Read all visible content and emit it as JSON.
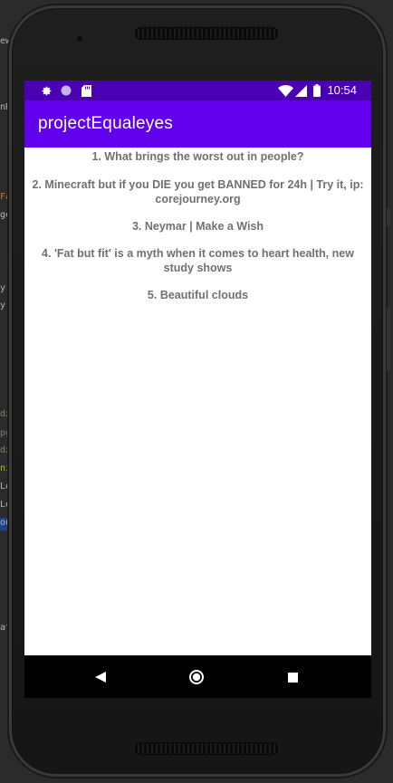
{
  "ide": {
    "fragments": [
      "ew",
      "nR",
      "Fa",
      "ge",
      "y",
      "y",
      "dx",
      "pg",
      "dx",
      "ni.",
      "Lo",
      "Lo",
      "ou",
      "at"
    ]
  },
  "status_bar": {
    "time": "10:54",
    "icons": [
      "settings-icon",
      "circle-icon",
      "sd-card-icon",
      "wifi-icon",
      "signal-icon",
      "battery-icon"
    ]
  },
  "app_bar": {
    "title": "projectEqualeyes"
  },
  "list": {
    "items": [
      "1. What brings the worst out in people?",
      "2. Minecraft but if you DIE you get BANNED for 24h | Try it, ip: corejourney.org",
      "3. Neymar | Make a Wish",
      "4. 'Fat but fit' is a myth when it comes to heart health, new study shows",
      "5. Beautiful clouds"
    ]
  },
  "nav_bar": {
    "buttons": [
      "back",
      "home",
      "recents"
    ]
  },
  "colors": {
    "status_bar": "#4a00b3",
    "app_bar": "#6200ee",
    "list_text": "#707070",
    "nav_bar": "#000000"
  }
}
